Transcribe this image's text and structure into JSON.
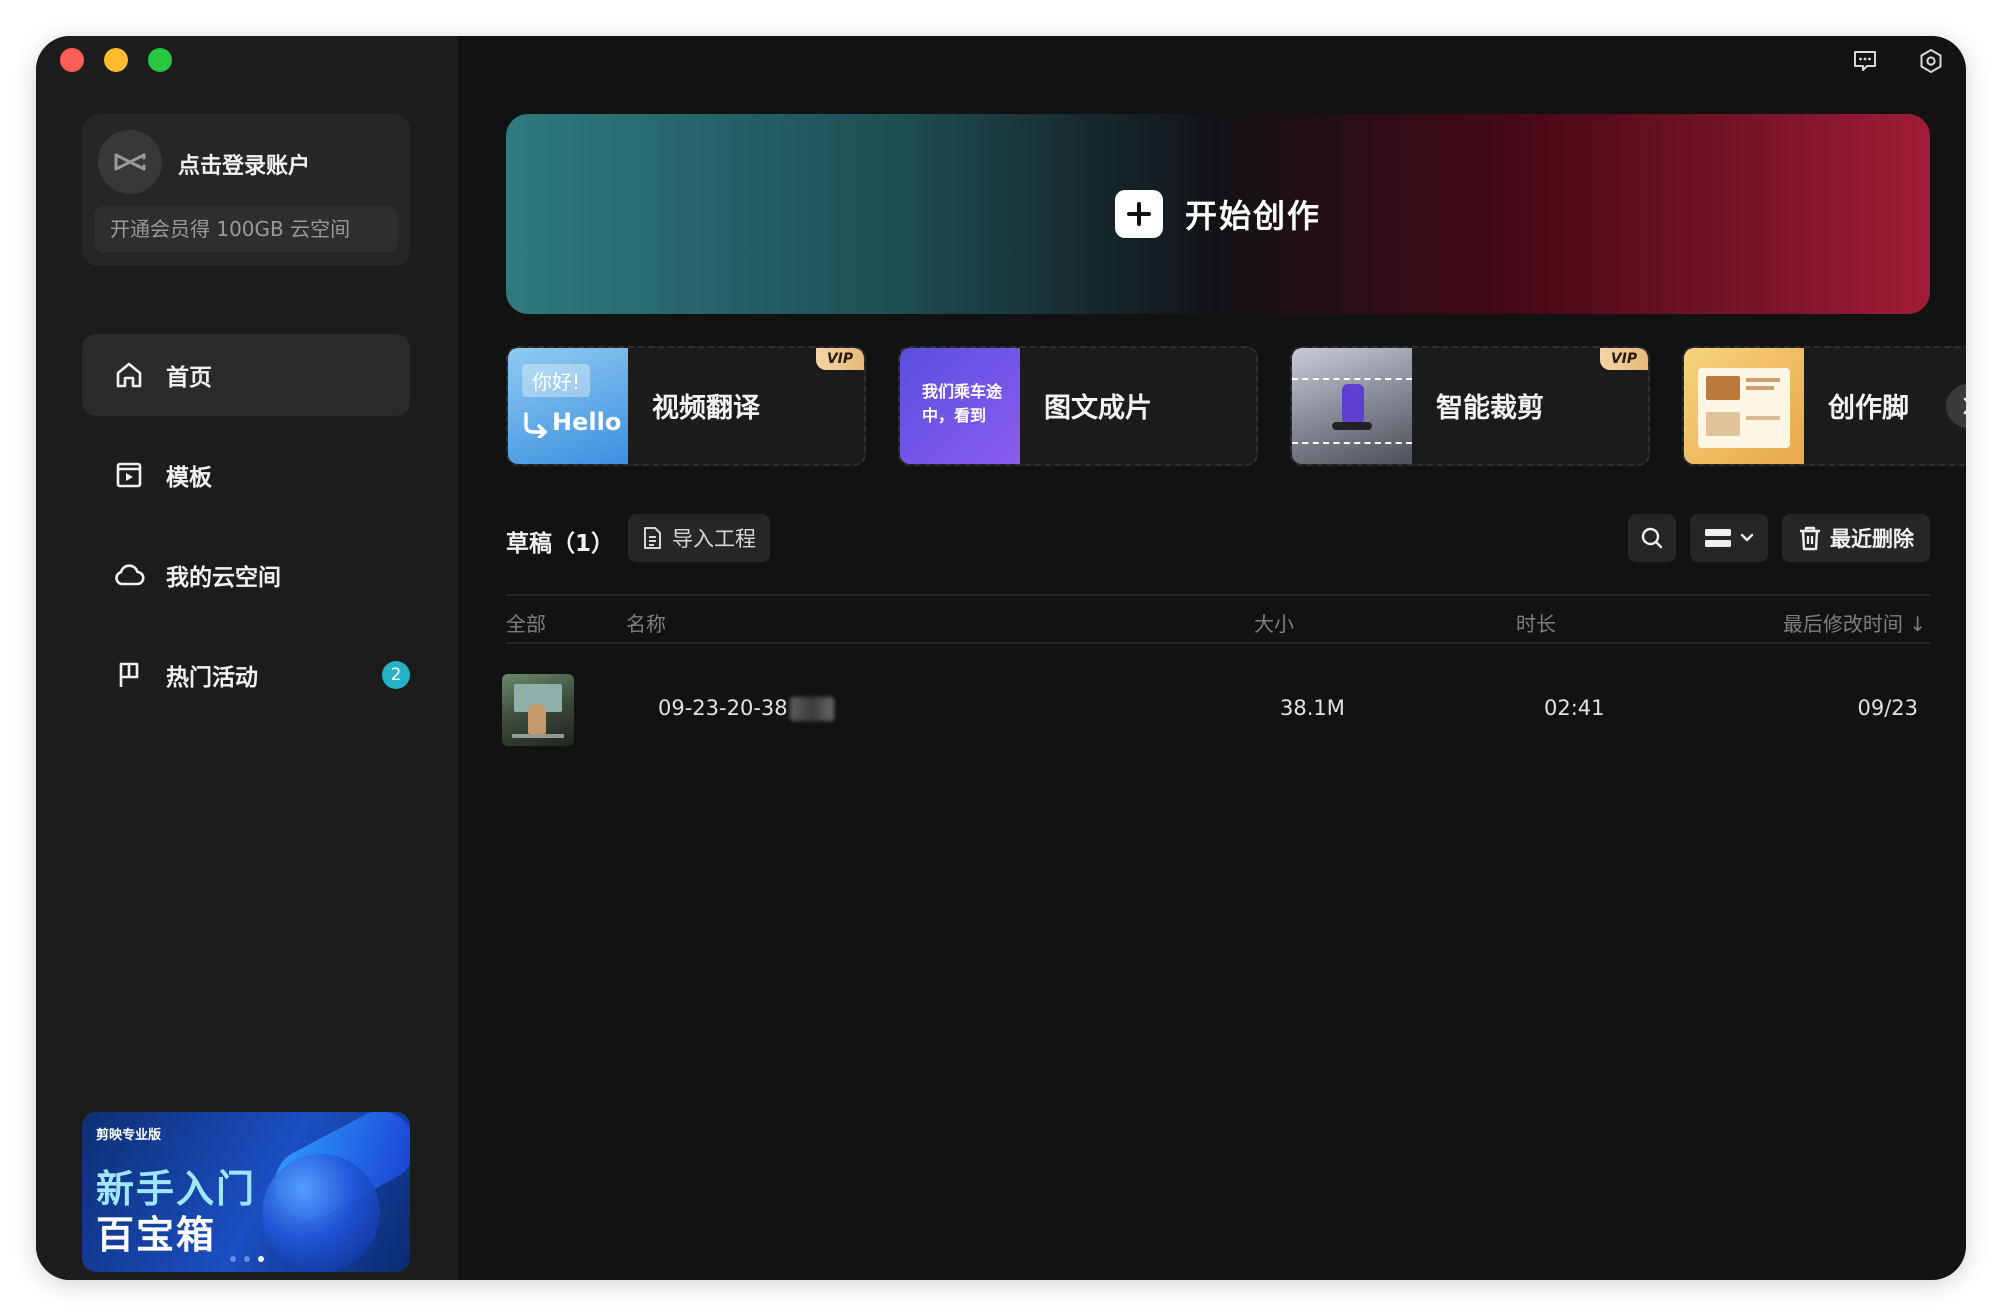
{
  "sidebar": {
    "account": {
      "login_label": "点击登录账户",
      "vip_prompt": "开通会员得 100GB 云空间"
    },
    "nav": [
      {
        "label": "首页",
        "icon": "home-icon",
        "active": true
      },
      {
        "label": "模板",
        "icon": "template-icon",
        "active": false
      },
      {
        "label": "我的云空间",
        "icon": "cloud-icon",
        "active": false
      },
      {
        "label": "热门活动",
        "icon": "flag-icon",
        "active": false,
        "badge": "2"
      }
    ],
    "promo": {
      "brand": "剪映专业版",
      "line1": "新手入门",
      "line2": "百宝箱"
    }
  },
  "header_icons": [
    "feedback-icon",
    "settings-icon"
  ],
  "hero": {
    "label": "开始创作"
  },
  "tools": [
    {
      "label": "视频翻译",
      "vip": true,
      "thumb_text_1": "你好!",
      "thumb_text_2": "Hello"
    },
    {
      "label": "图文成片",
      "vip": false,
      "thumb_text_1": "我们乘车途",
      "thumb_text_2": "中，看到"
    },
    {
      "label": "智能裁剪",
      "vip": true
    },
    {
      "label": "创作脚",
      "vip": false
    }
  ],
  "vip_tag_label": "VIP",
  "drafts": {
    "title": "草稿（1）",
    "import_label": "导入工程",
    "recent_delete_label": "最近删除"
  },
  "table": {
    "columns": {
      "all": "全部",
      "name": "名称",
      "size": "大小",
      "duration": "时长",
      "modified": "最后修改时间 ↓"
    },
    "rows": [
      {
        "name": "09-23-20-38",
        "size": "38.1M",
        "duration": "02:41",
        "modified": "09/23"
      }
    ]
  },
  "colors": {
    "accent_badge": "#25b4c6",
    "hero_left": "#2e7b80",
    "hero_right": "#a01c36",
    "vip_gold": "#e6b978"
  }
}
